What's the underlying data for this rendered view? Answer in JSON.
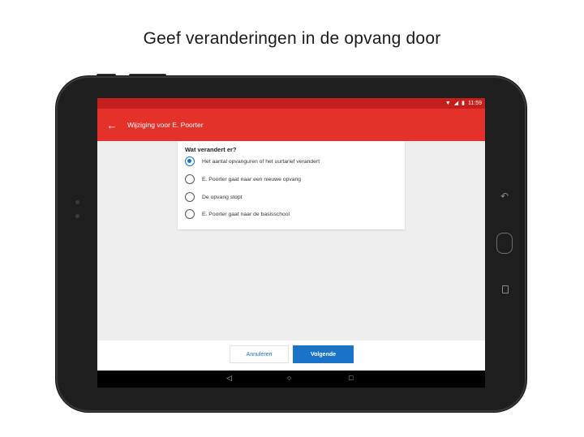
{
  "headline": "Geef veranderingen in de opvang door",
  "statusbar": {
    "time": "11:59",
    "icons": [
      "wifi-icon",
      "signal-icon",
      "battery-icon"
    ]
  },
  "appbar": {
    "back_icon": "arrow-left-icon",
    "title": "Wijziging voor E. Poorter",
    "color": "#e4322b"
  },
  "question": {
    "title": "Wat verandert er?",
    "options": [
      {
        "label": "Het aantal opvanguren of het uurtarief verandert",
        "selected": true
      },
      {
        "label": "E. Poorter gaat naar een nieuwe opvang",
        "selected": false
      },
      {
        "label": "De opvang stopt",
        "selected": false
      },
      {
        "label": "E. Poorter gaat naar de basisschool",
        "selected": false
      }
    ]
  },
  "footer": {
    "cancel_label": "Annuleren",
    "next_label": "Volgende",
    "accent": "#1a73c6"
  },
  "navbar": {
    "icons": [
      "nav-back-icon",
      "nav-home-icon",
      "nav-recents-icon"
    ]
  }
}
